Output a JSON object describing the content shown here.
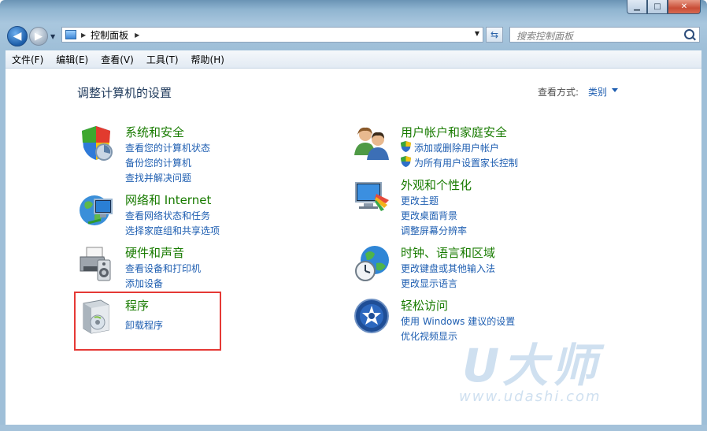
{
  "window": {
    "minimize": "▁",
    "maximize": "□",
    "close": "✕"
  },
  "address": {
    "path": "控制面板",
    "search_placeholder": "搜索控制面板"
  },
  "menu": [
    "文件(F)",
    "编辑(E)",
    "查看(V)",
    "工具(T)",
    "帮助(H)"
  ],
  "heading": "调整计算机的设置",
  "view_by": {
    "label": "查看方式:",
    "value": "类别"
  },
  "left_categories": [
    {
      "title": "系统和安全",
      "links": [
        "查看您的计算机状态",
        "备份您的计算机",
        "查找并解决问题"
      ]
    },
    {
      "title": "网络和 Internet",
      "links": [
        "查看网络状态和任务",
        "选择家庭组和共享选项"
      ]
    },
    {
      "title": "硬件和声音",
      "links": [
        "查看设备和打印机",
        "添加设备"
      ]
    },
    {
      "title": "程序",
      "links": [
        "卸载程序"
      ]
    }
  ],
  "right_categories": [
    {
      "title": "用户帐户和家庭安全",
      "links": [
        "添加或删除用户帐户",
        "为所有用户设置家长控制"
      ]
    },
    {
      "title": "外观和个性化",
      "links": [
        "更改主题",
        "更改桌面背景",
        "调整屏幕分辨率"
      ]
    },
    {
      "title": "时钟、语言和区域",
      "links": [
        "更改键盘或其他输入法",
        "更改显示语言"
      ]
    },
    {
      "title": "轻松访问",
      "links": [
        "使用 Windows 建议的设置",
        "优化视频显示"
      ]
    }
  ],
  "watermark": {
    "brand": "U大师",
    "url": "www.udashi.com"
  },
  "colors": {
    "category_title": "#187b00",
    "link": "#1e5eb1",
    "highlight": "#e53935"
  }
}
